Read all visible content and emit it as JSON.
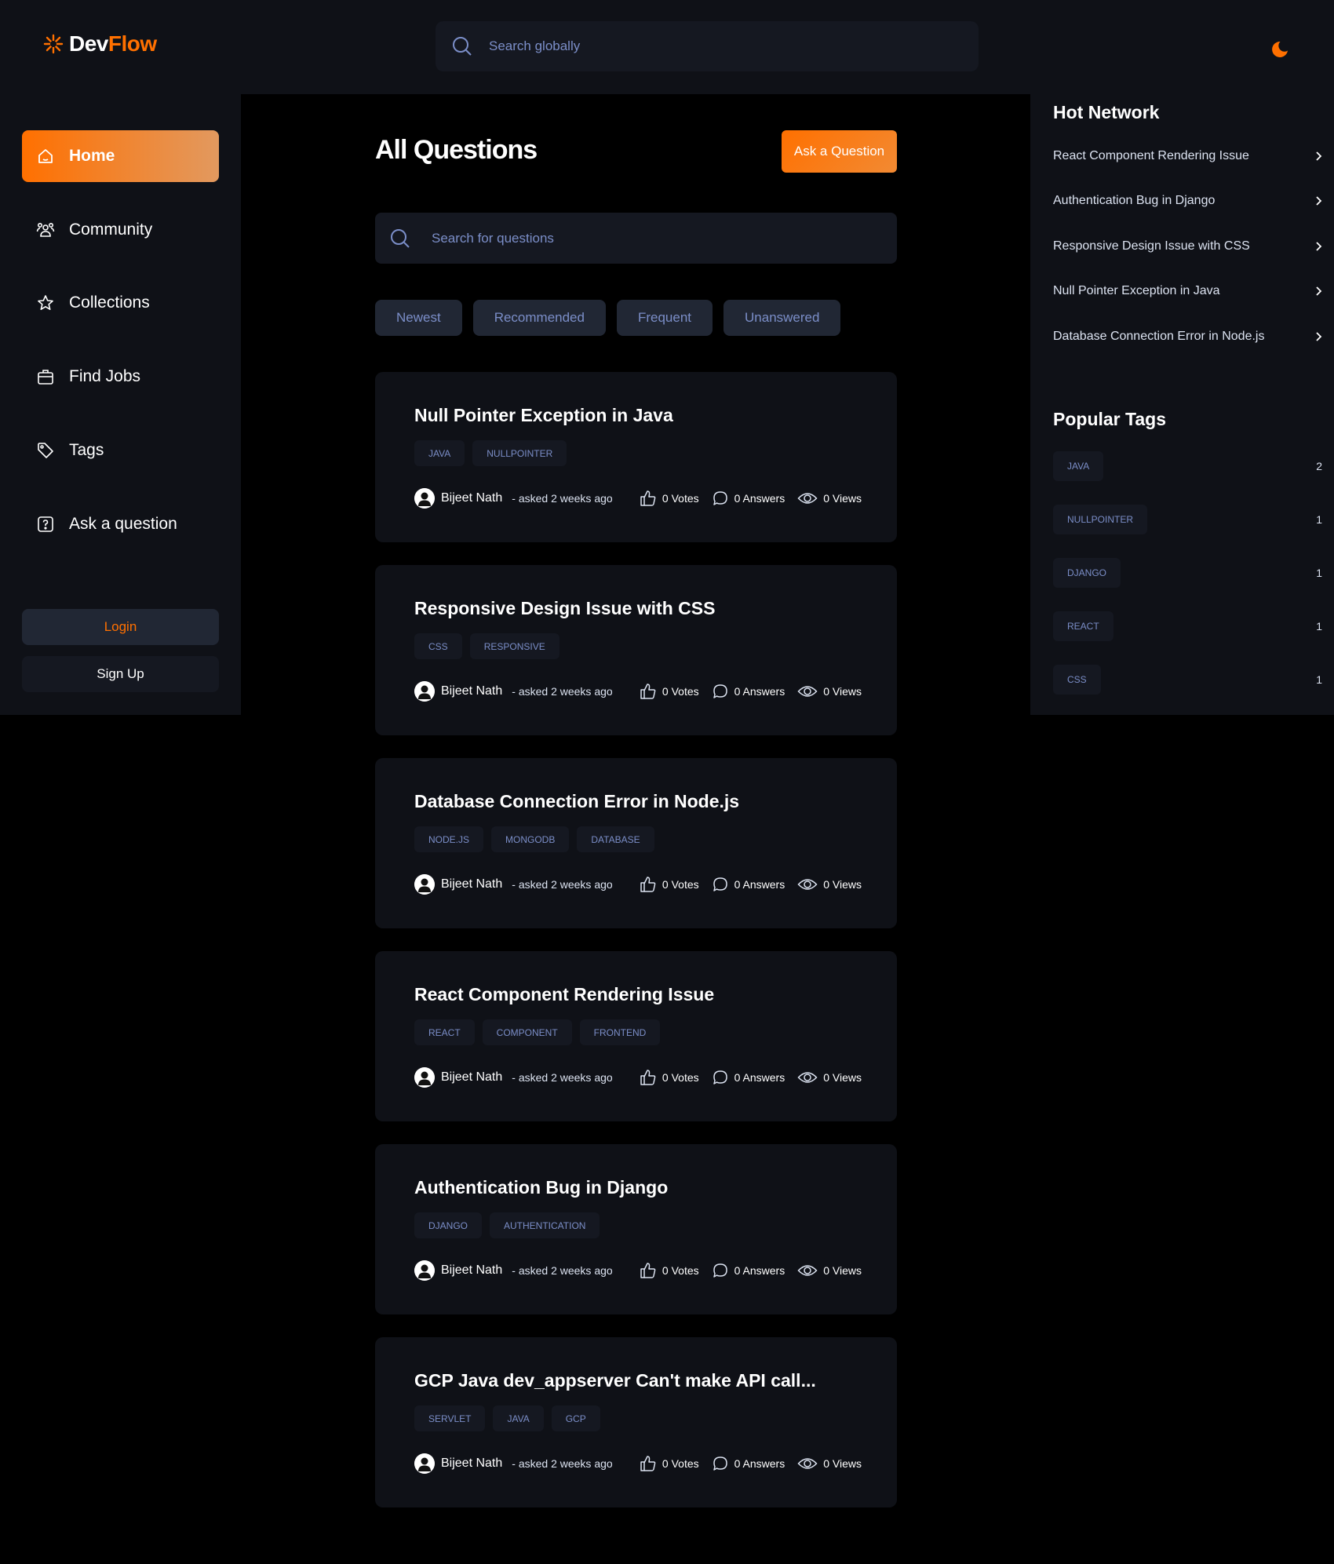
{
  "brand": {
    "part1": "Dev",
    "part2": "Flow",
    "accent": "#ff7000"
  },
  "global_search": {
    "placeholder": "Search globally",
    "icon": "search-icon"
  },
  "theme_toggle": {
    "icon": "moon-icon"
  },
  "sidebar": {
    "items": [
      {
        "label": "Home",
        "icon": "home-icon",
        "active": true
      },
      {
        "label": "Community",
        "icon": "users-icon"
      },
      {
        "label": "Collections",
        "icon": "star-icon"
      },
      {
        "label": "Find Jobs",
        "icon": "briefcase-icon"
      },
      {
        "label": "Tags",
        "icon": "tag-icon"
      },
      {
        "label": "Ask a question",
        "icon": "question-icon"
      }
    ],
    "login_label": "Login",
    "signup_label": "Sign Up"
  },
  "main": {
    "title": "All Questions",
    "ask_button": "Ask a Question",
    "search_placeholder": "Search for questions",
    "filters": [
      "Newest",
      "Recommended",
      "Frequent",
      "Unanswered"
    ]
  },
  "questions": [
    {
      "title": "Null Pointer Exception in Java",
      "tags": [
        "JAVA",
        "NULLPOINTER"
      ],
      "author": "Bijeet Nath",
      "asked": "- asked 2 weeks ago",
      "votes": "0 Votes",
      "answers": "0 Answers",
      "views": "0 Views"
    },
    {
      "title": "Responsive Design Issue with CSS",
      "tags": [
        "CSS",
        "RESPONSIVE"
      ],
      "author": "Bijeet Nath",
      "asked": "- asked 2 weeks ago",
      "votes": "0 Votes",
      "answers": "0 Answers",
      "views": "0 Views"
    },
    {
      "title": "Database Connection Error in Node.js",
      "tags": [
        "NODE.JS",
        "MONGODB",
        "DATABASE"
      ],
      "author": "Bijeet Nath",
      "asked": "- asked 2 weeks ago",
      "votes": "0 Votes",
      "answers": "0 Answers",
      "views": "0 Views"
    },
    {
      "title": "React Component Rendering Issue",
      "tags": [
        "REACT",
        "COMPONENT",
        "FRONTEND"
      ],
      "author": "Bijeet Nath",
      "asked": "- asked 2 weeks ago",
      "votes": "0 Votes",
      "answers": "0 Answers",
      "views": "0 Views"
    },
    {
      "title": "Authentication Bug in Django",
      "tags": [
        "DJANGO",
        "AUTHENTICATION"
      ],
      "author": "Bijeet Nath",
      "asked": "- asked 2 weeks ago",
      "votes": "0 Votes",
      "answers": "0 Answers",
      "views": "0 Views"
    },
    {
      "title": "GCP Java dev_appserver Can't make API call...",
      "tags": [
        "SERVLET",
        "JAVA",
        "GCP"
      ],
      "author": "Bijeet Nath",
      "asked": "- asked 2 weeks ago",
      "votes": "0 Votes",
      "answers": "0 Answers",
      "views": "0 Views"
    }
  ],
  "right_sidebar": {
    "hot_network_title": "Hot Network",
    "hot_network": [
      "React Component Rendering Issue",
      "Authentication Bug in Django",
      "Responsive Design Issue with CSS",
      "Null Pointer Exception in Java",
      "Database Connection Error in Node.js"
    ],
    "popular_tags_title": "Popular Tags",
    "popular_tags": [
      {
        "name": "JAVA",
        "count": "2"
      },
      {
        "name": "NULLPOINTER",
        "count": "1"
      },
      {
        "name": "DJANGO",
        "count": "1"
      },
      {
        "name": "REACT",
        "count": "1"
      },
      {
        "name": "CSS",
        "count": "1"
      }
    ]
  }
}
